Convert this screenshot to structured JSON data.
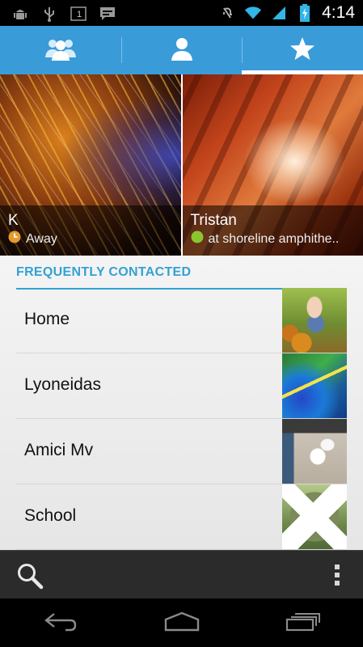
{
  "status_bar": {
    "time": "4:14",
    "notification_icons": [
      "android-debug-icon",
      "usb-icon",
      "notification-1-icon",
      "chat-icon"
    ],
    "status_icons": [
      "mute-icon",
      "wifi-icon",
      "signal-icon",
      "battery-charging-icon"
    ],
    "notification_badge": "1"
  },
  "tabs": [
    {
      "id": "groups",
      "icon": "groups-icon",
      "selected": false
    },
    {
      "id": "all",
      "icon": "person-icon",
      "selected": false
    },
    {
      "id": "favorites",
      "icon": "star-icon",
      "selected": true
    }
  ],
  "favorites": [
    {
      "name": "K",
      "status": "Away",
      "status_icon": "clock-icon",
      "status_color": "#e59a2e"
    },
    {
      "name": "Tristan",
      "status": "at shoreline amphithe..",
      "status_icon": "available-dot-icon",
      "status_color": "#8bc52f"
    }
  ],
  "frequent": {
    "header": "FREQUENTLY CONTACTED",
    "items": [
      {
        "name": "Home"
      },
      {
        "name": "Lyoneidas"
      },
      {
        "name": "Amici Mv"
      },
      {
        "name": "School"
      }
    ]
  },
  "bottom_bar": {
    "search_icon": "search-icon",
    "menu_icon": "overflow-menu-icon"
  },
  "nav_bar": {
    "back_icon": "back-icon",
    "home_icon": "home-icon",
    "recents_icon": "recent-apps-icon"
  },
  "colors": {
    "accent": "#33a1d3",
    "tab_bar": "#3a9bd9",
    "bottom_bar": "#2b2b2b"
  }
}
